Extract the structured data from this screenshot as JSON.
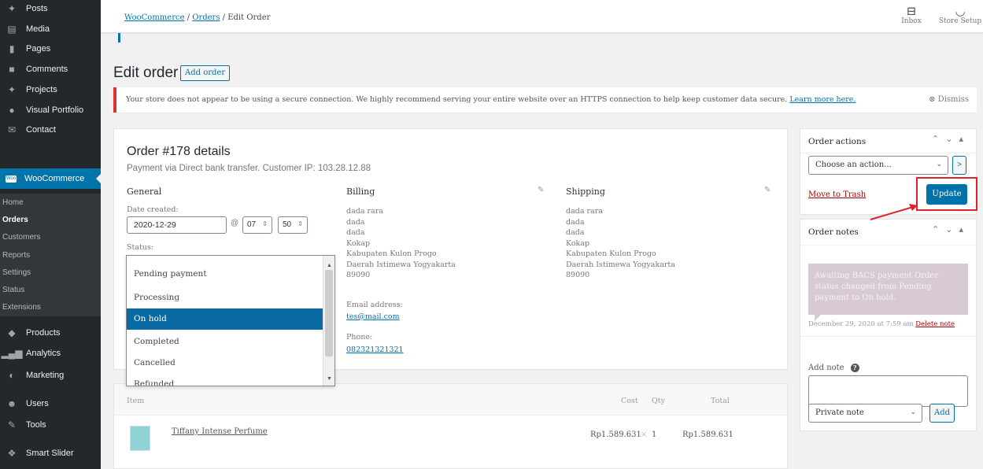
{
  "sidebar": {
    "items": [
      {
        "label": "Posts",
        "icon": "pin-icon"
      },
      {
        "label": "Media",
        "icon": "media-icon"
      },
      {
        "label": "Pages",
        "icon": "pages-icon"
      },
      {
        "label": "Comments",
        "icon": "comments-icon"
      },
      {
        "label": "Projects",
        "icon": "pin-icon"
      },
      {
        "label": "Visual Portfolio",
        "icon": "portfolio-icon"
      },
      {
        "label": "Contact",
        "icon": "mail-icon"
      },
      {
        "label": "WooCommerce",
        "icon": "woo-icon"
      },
      {
        "label": "Products",
        "icon": "products-icon"
      },
      {
        "label": "Analytics",
        "icon": "analytics-icon"
      },
      {
        "label": "Marketing",
        "icon": "marketing-icon"
      },
      {
        "label": "Users",
        "icon": "users-icon"
      },
      {
        "label": "Tools",
        "icon": "tools-icon"
      },
      {
        "label": "Smart Slider",
        "icon": "slider-icon"
      }
    ],
    "woo_badge": "Woo",
    "submenu": [
      "Home",
      "Orders",
      "Customers",
      "Reports",
      "Settings",
      "Status",
      "Extensions"
    ],
    "current_sub": "Orders"
  },
  "topbar": {
    "crumb_root": "WooCommerce",
    "crumb_sep": "/",
    "crumb_orders": "Orders",
    "crumb_current": "Edit Order",
    "inbox": "Inbox",
    "store_setup": "Store Setup"
  },
  "page": {
    "title": "Edit order",
    "add_order": "Add order"
  },
  "notice": {
    "text": "Your store does not appear to be using a secure connection. We highly recommend serving your entire website over an HTTPS connection to help keep customer data secure.",
    "link": "Learn more here.",
    "dismiss": "Dismiss"
  },
  "order": {
    "title": "Order #178 details",
    "subtitle": "Payment via Direct bank transfer. Customer IP: 103.28.12.88",
    "general": {
      "heading": "General",
      "date_label": "Date created:",
      "date": "2020-12-29",
      "at": "@",
      "hour": "07",
      "minute": "50",
      "status_label": "Status:"
    },
    "billing": {
      "heading": "Billing",
      "lines": [
        "dada rara",
        "dada",
        "dada",
        "Kokap",
        "Kabupaten Kulon Progo",
        "Daerah Istimewa Yogyakarta",
        "89090"
      ],
      "email_label": "Email address:",
      "email": "tes@mail.com",
      "phone_label": "Phone:",
      "phone": "082321321321"
    },
    "shipping": {
      "heading": "Shipping",
      "lines": [
        "dada rara",
        "dada",
        "dada",
        "Kokap",
        "Kabupaten Kulon Progo",
        "Daerah Istimewa Yogyakarta",
        "89090"
      ]
    }
  },
  "status_dropdown": {
    "options": [
      "Pending payment",
      "Processing",
      "On hold",
      "Completed",
      "Cancelled",
      "Refunded"
    ],
    "selected": "On hold"
  },
  "items_table": {
    "headers": {
      "item": "Item",
      "cost": "Cost",
      "qty": "Qty",
      "total": "Total"
    },
    "rows": [
      {
        "name": "Tiffany Intense Perfume",
        "cost": "Rp1.589.631",
        "qty_x": "×",
        "qty": "1",
        "total": "Rp1.589.631"
      }
    ]
  },
  "order_actions": {
    "title": "Order actions",
    "select": "Choose an action...",
    "go": ">",
    "trash": "Move to Trash",
    "update": "Update"
  },
  "order_notes": {
    "title": "Order notes",
    "note": "Awaiting BACS payment Order status changed from Pending payment to On hold.",
    "meta": "December 29, 2020 at 7:59 am",
    "delete": "Delete note",
    "add_label": "Add note",
    "type": "Private note",
    "add": "Add"
  },
  "colors": {
    "sidebar": "#23282d",
    "accent": "#0073aa",
    "notice_border": "#dc3232",
    "highlight": "#e0232a"
  }
}
